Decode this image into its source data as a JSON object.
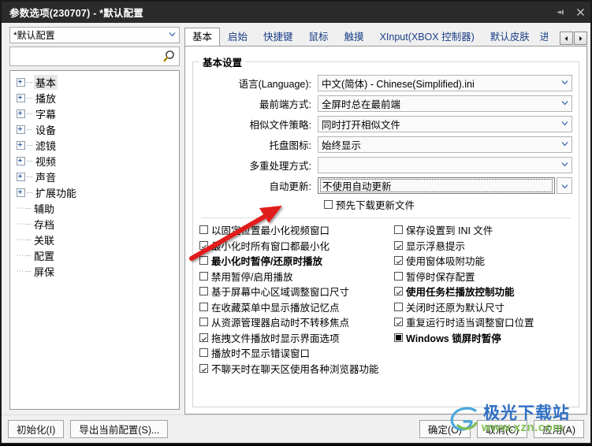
{
  "window": {
    "title": "参数选项(230707) - *默认配置",
    "pin_icon": "pin-icon",
    "close_icon": "close-icon"
  },
  "sidebar": {
    "profile": {
      "value": "*默认配置",
      "arrow": "chevron-down-icon"
    },
    "search": {
      "value": "",
      "placeholder": "",
      "icon": "search-icon"
    },
    "tree": [
      {
        "label": "基本",
        "expandable": true,
        "selected": true
      },
      {
        "label": "播放",
        "expandable": true,
        "selected": false
      },
      {
        "label": "字幕",
        "expandable": true,
        "selected": false
      },
      {
        "label": "设备",
        "expandable": true,
        "selected": false
      },
      {
        "label": "滤镜",
        "expandable": true,
        "selected": false
      },
      {
        "label": "视频",
        "expandable": true,
        "selected": false
      },
      {
        "label": "声音",
        "expandable": true,
        "selected": false
      },
      {
        "label": "扩展功能",
        "expandable": true,
        "selected": false
      },
      {
        "label": "辅助",
        "expandable": false,
        "selected": false
      },
      {
        "label": "存档",
        "expandable": false,
        "selected": false
      },
      {
        "label": "关联",
        "expandable": false,
        "selected": false
      },
      {
        "label": "配置",
        "expandable": false,
        "selected": false
      },
      {
        "label": "屏保",
        "expandable": false,
        "selected": false
      }
    ]
  },
  "tabs": {
    "items": [
      {
        "label": "基本",
        "active": true
      },
      {
        "label": "启始",
        "active": false
      },
      {
        "label": "快捷键",
        "active": false
      },
      {
        "label": "鼠标",
        "active": false
      },
      {
        "label": "触摸",
        "active": false
      },
      {
        "label": "XInput(XBOX 控制器)",
        "active": false
      },
      {
        "label": "默认皮肤",
        "active": false
      },
      {
        "label": "进",
        "active": false,
        "clipped": true
      }
    ],
    "scroll_prev": "◄",
    "scroll_next": "►"
  },
  "panel": {
    "group_title": "基本设置",
    "fields": [
      {
        "label": "语言(Language):",
        "value": "中文(简体) - Chinese(Simplified).ini",
        "focused": false
      },
      {
        "label": "最前端方式:",
        "value": "全屏时总在最前端",
        "focused": false
      },
      {
        "label": "相似文件策略:",
        "value": "同时打开相似文件",
        "focused": false
      },
      {
        "label": "托盘图标:",
        "value": "始终显示",
        "focused": false
      },
      {
        "label": "多重处理方式:",
        "value": "",
        "focused": false
      },
      {
        "label": "自动更新:",
        "value": "不使用自动更新",
        "focused": true
      }
    ],
    "sub_check": {
      "label": "预先下载更新文件",
      "state": "unchecked"
    },
    "checks_left": [
      {
        "label": "以固定位置最小化视频窗口",
        "state": "unchecked",
        "bold": false
      },
      {
        "label": "最小化时所有窗口都最小化",
        "state": "checked",
        "bold": false
      },
      {
        "label": "最小化时暂停/还原时播放",
        "state": "unchecked",
        "bold": true
      },
      {
        "label": "禁用暂停/启用播放",
        "state": "unchecked",
        "bold": false
      },
      {
        "label": "基于屏幕中心区域调整窗口尺寸",
        "state": "unchecked",
        "bold": false
      },
      {
        "label": "在收藏菜单中显示播放记忆点",
        "state": "unchecked",
        "bold": false
      },
      {
        "label": "从资源管理器启动时不转移焦点",
        "state": "unchecked",
        "bold": false
      },
      {
        "label": "拖拽文件播放时显示界面选项",
        "state": "checked",
        "bold": false
      },
      {
        "label": "播放时不显示错误窗口",
        "state": "unchecked",
        "bold": false
      },
      {
        "label": "不聊天时在聊天区使用各种浏览器功能",
        "state": "checked",
        "bold": false
      }
    ],
    "checks_right": [
      {
        "label": "保存设置到 INI 文件",
        "state": "unchecked",
        "bold": false
      },
      {
        "label": "显示浮悬提示",
        "state": "checked",
        "bold": false
      },
      {
        "label": "使用窗体吸附功能",
        "state": "checked",
        "bold": false
      },
      {
        "label": "暂停时保存配置",
        "state": "unchecked",
        "bold": false
      },
      {
        "label": "使用任务栏播放控制功能",
        "state": "checked",
        "bold": true
      },
      {
        "label": "关闭时还原为默认尺寸",
        "state": "unchecked",
        "bold": false
      },
      {
        "label": "重复运行时适当调整窗口位置",
        "state": "checked",
        "bold": false
      },
      {
        "label": "Windows 锁屏时暂停",
        "state": "indeterminate",
        "bold": true
      }
    ]
  },
  "footer": {
    "init_button": "初始化(I)",
    "export_button": "导出当前配置(S)...",
    "ok_button": "确定(O)",
    "cancel_button": "取消(C)",
    "apply_button": "应用(A)"
  },
  "watermark": {
    "main": "极光下载站",
    "sub": "www.xzn.com"
  },
  "colors": {
    "titlebar": "#2b2b2b",
    "tab_text": "#1a3f87",
    "accent_arrow": "#2f5fa8",
    "annotation": "#e01b1b",
    "watermark_blue": "#2e6fc4",
    "watermark_green": "#7fbf56"
  }
}
